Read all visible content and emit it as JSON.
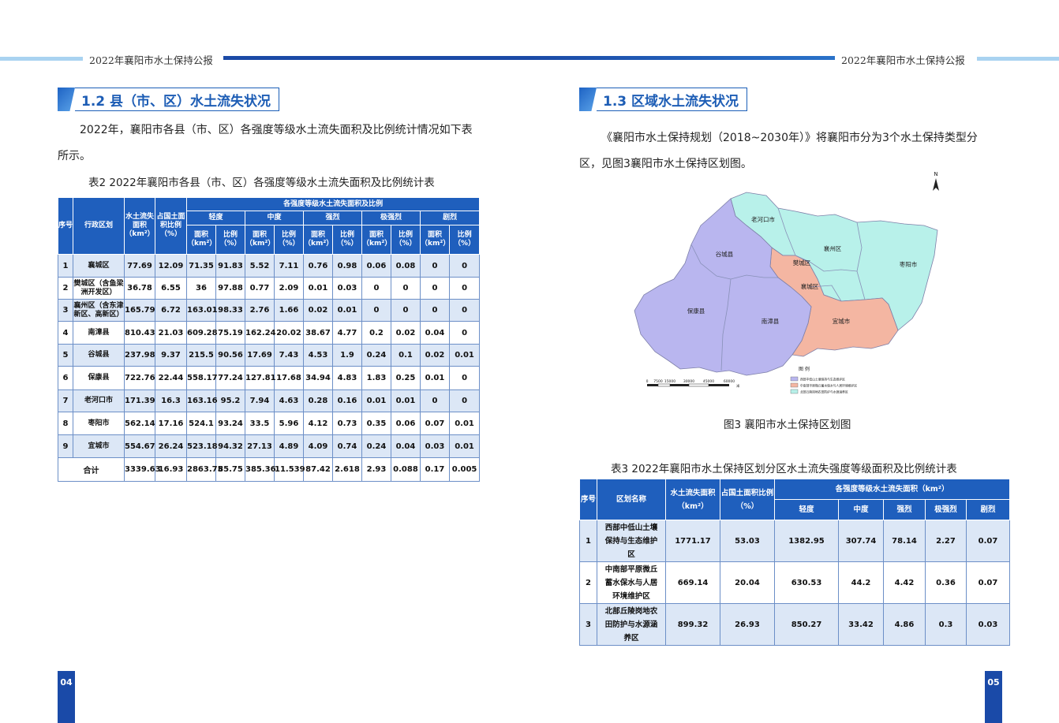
{
  "header": {
    "left_title": "2022年襄阳市水土保持公报",
    "right_title": "2022年襄阳市水土保持公报"
  },
  "left": {
    "section_title": "1.2 县（市、区）水土流失状况",
    "para_line1": "2022年，襄阳市各县（市、区）各强度等级水土流失面积及比例统计情况如下表",
    "para_line2": "所示。",
    "table_caption": "表2  2022年襄阳市各县（市、区）各强度等级水土流失面积及比例统计表",
    "page_number": "04",
    "table2": {
      "h_seq": "序号",
      "h_region": "行政区划",
      "h_area": "水土流失面积（km²）",
      "h_ratio": "占国土面积比例（%）",
      "h_group": "各强度等级水土流失面积及比例",
      "levels": [
        "轻度",
        "中度",
        "强烈",
        "极强烈",
        "剧烈"
      ],
      "sub_area": "面积（km²）",
      "sub_ratio": "比例（%）",
      "rows": [
        [
          "1",
          "襄城区",
          "77.69",
          "12.09",
          "71.35",
          "91.83",
          "5.52",
          "7.11",
          "0.76",
          "0.98",
          "0.06",
          "0.08",
          "0",
          "0"
        ],
        [
          "2",
          "樊城区（含鱼梁洲开发区）",
          "36.78",
          "6.55",
          "36",
          "97.88",
          "0.77",
          "2.09",
          "0.01",
          "0.03",
          "0",
          "0",
          "0",
          "0"
        ],
        [
          "3",
          "襄州区（含东津新区、高新区）",
          "165.79",
          "6.72",
          "163.01",
          "98.33",
          "2.76",
          "1.66",
          "0.02",
          "0.01",
          "0",
          "0",
          "0",
          "0"
        ],
        [
          "4",
          "南漳县",
          "810.43",
          "21.03",
          "609.28",
          "75.19",
          "162.24",
          "20.02",
          "38.67",
          "4.77",
          "0.2",
          "0.02",
          "0.04",
          "0"
        ],
        [
          "5",
          "谷城县",
          "237.98",
          "9.37",
          "215.5",
          "90.56",
          "17.69",
          "7.43",
          "4.53",
          "1.9",
          "0.24",
          "0.1",
          "0.02",
          "0.01"
        ],
        [
          "6",
          "保康县",
          "722.76",
          "22.44",
          "558.17",
          "77.24",
          "127.81",
          "17.68",
          "34.94",
          "4.83",
          "1.83",
          "0.25",
          "0.01",
          "0"
        ],
        [
          "7",
          "老河口市",
          "171.39",
          "16.3",
          "163.16",
          "95.2",
          "7.94",
          "4.63",
          "0.28",
          "0.16",
          "0.01",
          "0.01",
          "0",
          "0"
        ],
        [
          "8",
          "枣阳市",
          "562.14",
          "17.16",
          "524.1",
          "93.24",
          "33.5",
          "5.96",
          "4.12",
          "0.73",
          "0.35",
          "0.06",
          "0.07",
          "0.01"
        ],
        [
          "9",
          "宜城市",
          "554.67",
          "26.24",
          "523.18",
          "94.32",
          "27.13",
          "4.89",
          "4.09",
          "0.74",
          "0.24",
          "0.04",
          "0.03",
          "0.01"
        ]
      ],
      "total": [
        "合计",
        "3339.63",
        "16.93",
        "2863.75",
        "85.75",
        "385.36",
        "11.539",
        "87.42",
        "2.618",
        "2.93",
        "0.088",
        "0.17",
        "0.005"
      ]
    }
  },
  "right": {
    "section_title": "1.3 区域水土流失状况",
    "para_line1": "《襄阳市水土保持规划（2018~2030年）》将襄阳市分为3个水土保持类型分",
    "para_line2": "区，见图3襄阳市水土保持区划图。",
    "figure_caption": "图3  襄阳市水土保持区划图",
    "table_caption": "表3  2022年襄阳市水土保持区划分区水土流失强度等级面积及比例统计表",
    "page_number": "05",
    "map": {
      "north": "N",
      "labels": {
        "laohekou": "老河口市",
        "gucheng": "谷城县",
        "xiangzhou": "襄州区",
        "zaoyang": "枣阳市",
        "fancheng": "樊城区",
        "xiangcheng": "襄城区",
        "baokang": "保康县",
        "nanzhang": "南漳县",
        "yicheng": "宜城市"
      },
      "legend_title": "图  例",
      "legend_items": [
        "西部中低山土壤保持与生态维护区",
        "中南部平原微丘蓄水保水与人居环境维护区",
        "北部丘陵岗地农田防护与水源涵养区"
      ],
      "scale_ticks": [
        "0",
        "7500",
        "15000",
        "30000",
        "45000",
        "60000"
      ],
      "scale_unit": "米",
      "colors": {
        "west": "#b9b6ef",
        "south": "#f4b6a2",
        "north": "#b8f1ea"
      }
    },
    "table3": {
      "h_seq": "序号",
      "h_name": "区划名称",
      "h_area": "水土流失面积（km²）",
      "h_ratio": "占国土面积比例（%）",
      "h_group": "各强度等级水土流失面积（km²）",
      "levels": [
        "轻度",
        "中度",
        "强烈",
        "极强烈",
        "剧烈"
      ],
      "rows": [
        [
          "1",
          "西部中低山土壤保持与生态维护区",
          "1771.17",
          "53.03",
          "1382.95",
          "307.74",
          "78.14",
          "2.27",
          "0.07"
        ],
        [
          "2",
          "中南部平原微丘蓄水保水与人居环境维护区",
          "669.14",
          "20.04",
          "630.53",
          "44.2",
          "4.42",
          "0.36",
          "0.07"
        ],
        [
          "3",
          "北部丘陵岗地农田防护与水源涵养区",
          "899.32",
          "26.93",
          "850.27",
          "33.42",
          "4.86",
          "0.3",
          "0.03"
        ]
      ]
    }
  }
}
